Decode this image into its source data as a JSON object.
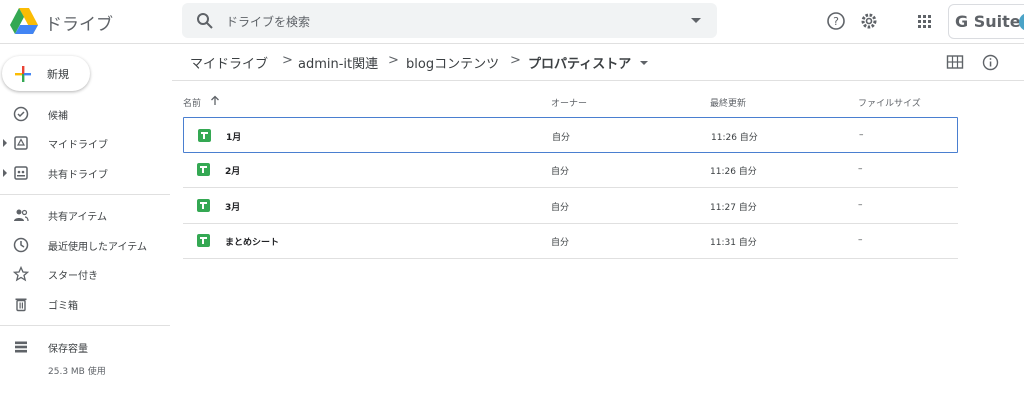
{
  "app": {
    "title": "ドライブ"
  },
  "search": {
    "placeholder": "ドライブを検索"
  },
  "brand": {
    "gsuite": "G Suite"
  },
  "sidebar": {
    "new_label": "新規",
    "items": [
      {
        "label": "候補",
        "icon": "check-box-icon"
      },
      {
        "label": "マイドライブ",
        "icon": "my-drive-icon"
      },
      {
        "label": "共有ドライブ",
        "icon": "shared-drive-icon"
      },
      {
        "label": "共有アイテム",
        "icon": "people-icon"
      },
      {
        "label": "最近使用したアイテム",
        "icon": "clock-icon"
      },
      {
        "label": "スター付き",
        "icon": "star-icon"
      },
      {
        "label": "ゴミ箱",
        "icon": "trash-icon"
      }
    ],
    "storage": {
      "label": "保存容量",
      "used": "25.3 MB 使用"
    }
  },
  "breadcrumb": {
    "items": [
      "マイドライブ",
      "admin-it関連",
      "blogコンテンツ",
      "プロパティストア"
    ],
    "separator": ">"
  },
  "table": {
    "columns": {
      "name": "名前",
      "owner": "オーナー",
      "modified": "最終更新",
      "size": "ファイルサイズ"
    },
    "rows": [
      {
        "name": "1月",
        "owner": "自分",
        "modified": "11:26 自分",
        "size": "–"
      },
      {
        "name": "2月",
        "owner": "自分",
        "modified": "11:26 自分",
        "size": "–"
      },
      {
        "name": "3月",
        "owner": "自分",
        "modified": "11:27 自分",
        "size": "–"
      },
      {
        "name": "まとめシート",
        "owner": "自分",
        "modified": "11:31 自分",
        "size": "–"
      }
    ]
  },
  "colors": {
    "accent": "#4a7fd0",
    "sheets": "#34a853"
  }
}
